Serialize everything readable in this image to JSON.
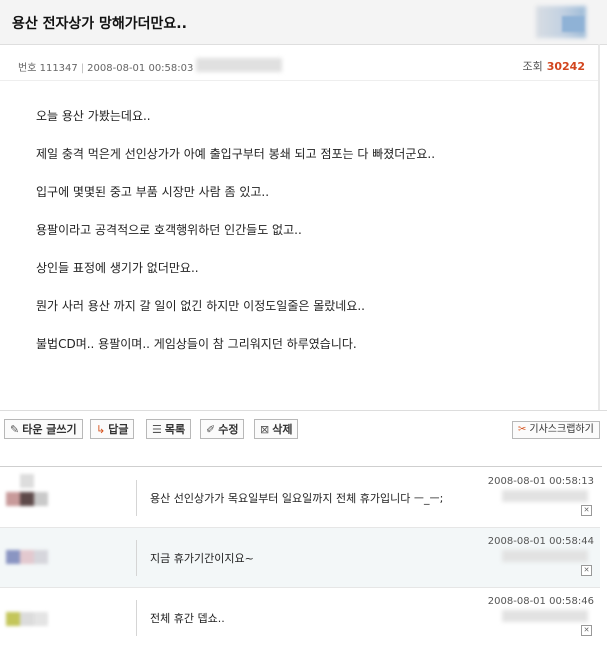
{
  "post": {
    "title": "용산 전자상가 망해가더만요..",
    "number_label": "번호",
    "number": "111347",
    "datetime": "2008-08-01 00:58:03",
    "views_label": "조회",
    "views": "30242",
    "body": [
      "오늘 용산 가봤는데요..",
      "제일 충격 먹은게 선인상가가 아예 출입구부터 봉쇄 되고 점포는 다 빠졌더군요..",
      "입구에 몇몇된 중고 부품 시장만 사람 좀 있고..",
      "용팔이라고 공격적으로 호객행위하던 인간들도 없고..",
      "상인들 표정에 생기가 없더만요..",
      "뭔가 사러 용산 까지 갈 일이 없긴 하지만 이정도일줄은 몰랐네요..",
      "불법CD며.. 용팔이며.. 게임상들이 참 그리워지던 하루였습니다."
    ]
  },
  "toolbar": {
    "write_label": "타운 글쓰기",
    "reply_label": "답글",
    "list_label": "목록",
    "edit_label": "수정",
    "delete_label": "삭제",
    "scrap_label": "기사스크랩하기"
  },
  "comments": [
    {
      "datetime": "2008-08-01 00:58:13",
      "text": "용산 선인상가가 목요일부터 일요일까지 전체 휴가입니다 ㅡ_ㅡ;"
    },
    {
      "datetime": "2008-08-01 00:58:44",
      "text": "지금 휴가기간이지요~"
    },
    {
      "datetime": "2008-08-01 00:58:46",
      "text": "전체 휴간 뎁쇼.."
    }
  ],
  "colors": {
    "views_number": "#d2451e",
    "comment_alt_bg": "#f3f7f8"
  }
}
